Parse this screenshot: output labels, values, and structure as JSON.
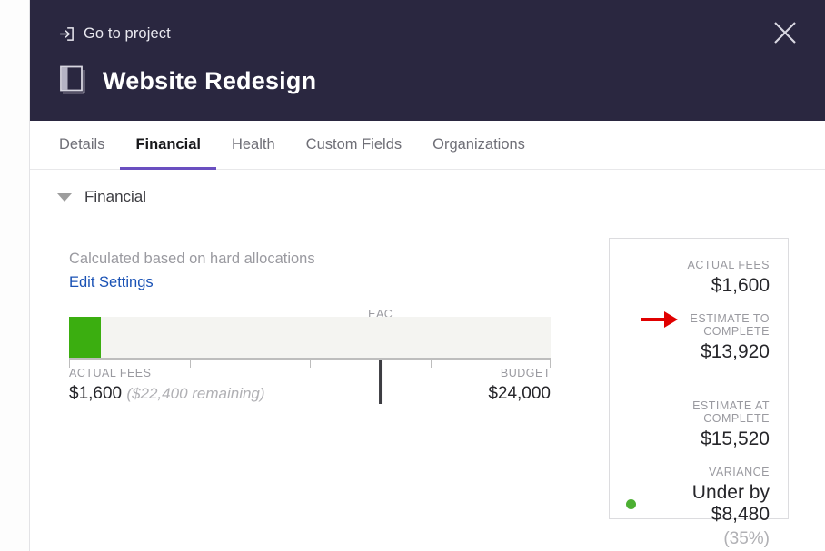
{
  "header": {
    "goto_project_label": "Go to project",
    "goto_icon": "enter-icon",
    "project_title": "Website Redesign",
    "project_icon": "book-icon",
    "close_icon": "close-icon",
    "background_color": "#2a2740"
  },
  "tabs": [
    {
      "label": "Details",
      "active": false
    },
    {
      "label": "Financial",
      "active": true
    },
    {
      "label": "Health",
      "active": false
    },
    {
      "label": "Custom Fields",
      "active": false
    },
    {
      "label": "Organizations",
      "active": false
    }
  ],
  "section": {
    "collapse_icon": "chevron-down-icon",
    "title": "Financial"
  },
  "main": {
    "calculation_note": "Calculated based on hard allocations",
    "edit_settings_label": "Edit Settings",
    "edit_settings_color": "#1a52b5"
  },
  "chart_data": {
    "type": "bar",
    "title": "",
    "orientation": "horizontal",
    "categories": [
      "Actual Fees"
    ],
    "values": [
      1600
    ],
    "xlim": [
      0,
      24000
    ],
    "grid": false,
    "axis_ticks": [
      0,
      6000,
      12000,
      18000,
      24000
    ],
    "bar_color": "#3bae10",
    "track_color": "#f4f4f1",
    "marker": {
      "label": "EAC",
      "value": 15520,
      "value_display": "$15,520",
      "color": "#3d3d42"
    },
    "left_label": {
      "caption": "ACTUAL FEES",
      "value": "$1,600",
      "annotation": "($22,400 remaining)"
    },
    "right_label": {
      "caption": "BUDGET",
      "value": "$24,000"
    }
  },
  "summary": {
    "actual_fees": {
      "caption": "ACTUAL FEES",
      "value": "$1,600"
    },
    "estimate_to_complete": {
      "caption": "ESTIMATE TO COMPLETE",
      "value": "$13,920"
    },
    "estimate_at_complete": {
      "caption": "ESTIMATE AT COMPLETE",
      "value": "$15,520"
    },
    "variance": {
      "caption": "VARIANCE",
      "value": "Under by $8,480",
      "percent": "(35%)",
      "status_color": "#4caf32"
    }
  },
  "annotation": {
    "arrow_icon": "right-arrow-annotation-icon",
    "color": "#e00000",
    "points_at": "ESTIMATE TO COMPLETE"
  }
}
